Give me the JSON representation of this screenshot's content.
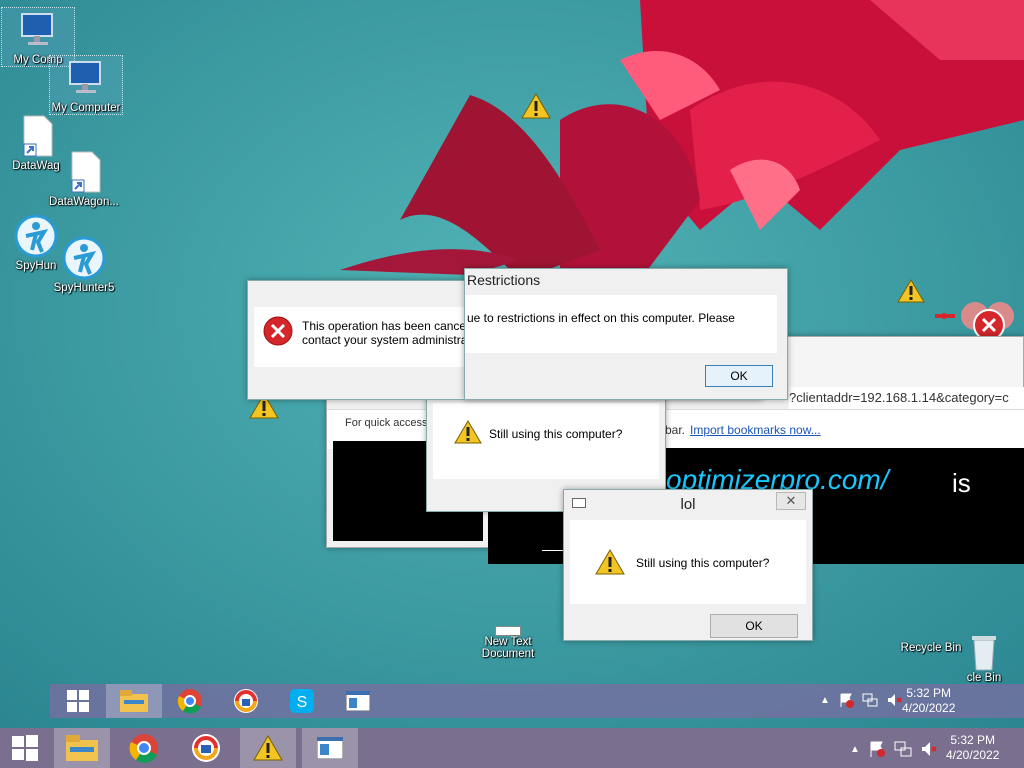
{
  "desktop_icons": [
    {
      "label": "My Comp"
    },
    {
      "label": "My Computer"
    },
    {
      "label": "DataWag"
    },
    {
      "label": "DataWagon..."
    },
    {
      "label": "SpyHun"
    },
    {
      "label": "SpyHunter5"
    },
    {
      "label": "New Text Document"
    },
    {
      "label": "Recycle Bin"
    },
    {
      "label": "cle Bin"
    }
  ],
  "dialog_cancelled": {
    "line1": "This operation has been cancelled",
    "line2": "contact your system administrator."
  },
  "dialog_restrictions": {
    "title": "Restrictions",
    "text": "ue to restrictions in effect on this computer. Please",
    "ok": "OK"
  },
  "browser": {
    "url": "?clientaddr=192.168.1.14&category=c",
    "bookmarks_left": "For quick access,",
    "bookmarks_right": "bar.",
    "import_link": "Import bookmarks now...",
    "banner_link": "optimizerpro.com/",
    "banner_text": "is"
  },
  "dialog_still_back": {
    "text": "Still using this computer?"
  },
  "dialog_lol": {
    "title": "lol",
    "text": "Still using this computer?",
    "ok": "OK"
  },
  "taskbar_lower": {
    "time": "5:32 PM",
    "date": "4/20/2022"
  },
  "taskbar_upper": {
    "time": "5:32 PM",
    "date": "4/20/2022"
  },
  "colors": {
    "accent_link": "#1e90ff",
    "banner_cyan": "#19c8ff",
    "error_red": "#d3272c"
  }
}
